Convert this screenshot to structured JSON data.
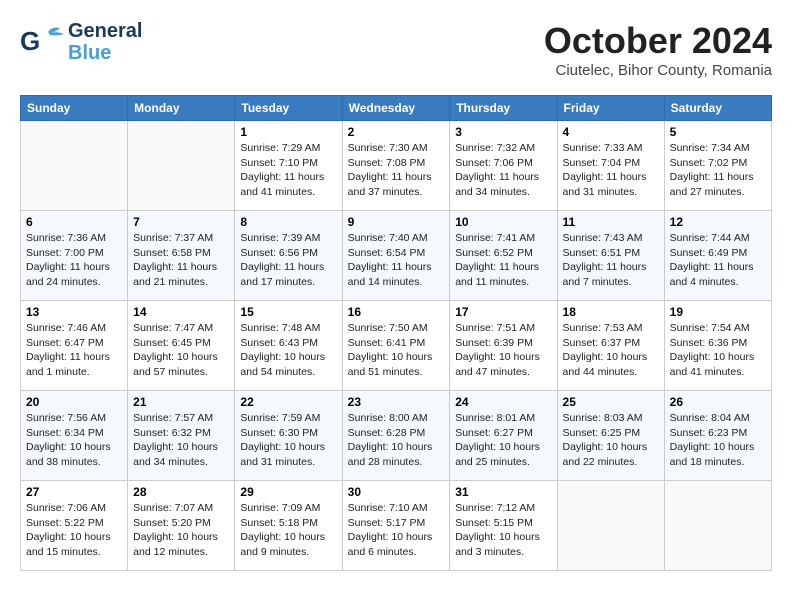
{
  "header": {
    "logo_line1": "General",
    "logo_line2": "Blue",
    "month_title": "October 2024",
    "location": "Ciutelec, Bihor County, Romania"
  },
  "days_of_week": [
    "Sunday",
    "Monday",
    "Tuesday",
    "Wednesday",
    "Thursday",
    "Friday",
    "Saturday"
  ],
  "weeks": [
    [
      null,
      null,
      {
        "day": 1,
        "sunrise": "7:29 AM",
        "sunset": "7:10 PM",
        "daylight": "11 hours and 41 minutes."
      },
      {
        "day": 2,
        "sunrise": "7:30 AM",
        "sunset": "7:08 PM",
        "daylight": "11 hours and 37 minutes."
      },
      {
        "day": 3,
        "sunrise": "7:32 AM",
        "sunset": "7:06 PM",
        "daylight": "11 hours and 34 minutes."
      },
      {
        "day": 4,
        "sunrise": "7:33 AM",
        "sunset": "7:04 PM",
        "daylight": "11 hours and 31 minutes."
      },
      {
        "day": 5,
        "sunrise": "7:34 AM",
        "sunset": "7:02 PM",
        "daylight": "11 hours and 27 minutes."
      }
    ],
    [
      {
        "day": 6,
        "sunrise": "7:36 AM",
        "sunset": "7:00 PM",
        "daylight": "11 hours and 24 minutes."
      },
      {
        "day": 7,
        "sunrise": "7:37 AM",
        "sunset": "6:58 PM",
        "daylight": "11 hours and 21 minutes."
      },
      {
        "day": 8,
        "sunrise": "7:39 AM",
        "sunset": "6:56 PM",
        "daylight": "11 hours and 17 minutes."
      },
      {
        "day": 9,
        "sunrise": "7:40 AM",
        "sunset": "6:54 PM",
        "daylight": "11 hours and 14 minutes."
      },
      {
        "day": 10,
        "sunrise": "7:41 AM",
        "sunset": "6:52 PM",
        "daylight": "11 hours and 11 minutes."
      },
      {
        "day": 11,
        "sunrise": "7:43 AM",
        "sunset": "6:51 PM",
        "daylight": "11 hours and 7 minutes."
      },
      {
        "day": 12,
        "sunrise": "7:44 AM",
        "sunset": "6:49 PM",
        "daylight": "11 hours and 4 minutes."
      }
    ],
    [
      {
        "day": 13,
        "sunrise": "7:46 AM",
        "sunset": "6:47 PM",
        "daylight": "11 hours and 1 minute."
      },
      {
        "day": 14,
        "sunrise": "7:47 AM",
        "sunset": "6:45 PM",
        "daylight": "10 hours and 57 minutes."
      },
      {
        "day": 15,
        "sunrise": "7:48 AM",
        "sunset": "6:43 PM",
        "daylight": "10 hours and 54 minutes."
      },
      {
        "day": 16,
        "sunrise": "7:50 AM",
        "sunset": "6:41 PM",
        "daylight": "10 hours and 51 minutes."
      },
      {
        "day": 17,
        "sunrise": "7:51 AM",
        "sunset": "6:39 PM",
        "daylight": "10 hours and 47 minutes."
      },
      {
        "day": 18,
        "sunrise": "7:53 AM",
        "sunset": "6:37 PM",
        "daylight": "10 hours and 44 minutes."
      },
      {
        "day": 19,
        "sunrise": "7:54 AM",
        "sunset": "6:36 PM",
        "daylight": "10 hours and 41 minutes."
      }
    ],
    [
      {
        "day": 20,
        "sunrise": "7:56 AM",
        "sunset": "6:34 PM",
        "daylight": "10 hours and 38 minutes."
      },
      {
        "day": 21,
        "sunrise": "7:57 AM",
        "sunset": "6:32 PM",
        "daylight": "10 hours and 34 minutes."
      },
      {
        "day": 22,
        "sunrise": "7:59 AM",
        "sunset": "6:30 PM",
        "daylight": "10 hours and 31 minutes."
      },
      {
        "day": 23,
        "sunrise": "8:00 AM",
        "sunset": "6:28 PM",
        "daylight": "10 hours and 28 minutes."
      },
      {
        "day": 24,
        "sunrise": "8:01 AM",
        "sunset": "6:27 PM",
        "daylight": "10 hours and 25 minutes."
      },
      {
        "day": 25,
        "sunrise": "8:03 AM",
        "sunset": "6:25 PM",
        "daylight": "10 hours and 22 minutes."
      },
      {
        "day": 26,
        "sunrise": "8:04 AM",
        "sunset": "6:23 PM",
        "daylight": "10 hours and 18 minutes."
      }
    ],
    [
      {
        "day": 27,
        "sunrise": "7:06 AM",
        "sunset": "5:22 PM",
        "daylight": "10 hours and 15 minutes."
      },
      {
        "day": 28,
        "sunrise": "7:07 AM",
        "sunset": "5:20 PM",
        "daylight": "10 hours and 12 minutes."
      },
      {
        "day": 29,
        "sunrise": "7:09 AM",
        "sunset": "5:18 PM",
        "daylight": "10 hours and 9 minutes."
      },
      {
        "day": 30,
        "sunrise": "7:10 AM",
        "sunset": "5:17 PM",
        "daylight": "10 hours and 6 minutes."
      },
      {
        "day": 31,
        "sunrise": "7:12 AM",
        "sunset": "5:15 PM",
        "daylight": "10 hours and 3 minutes."
      },
      null,
      null
    ]
  ]
}
